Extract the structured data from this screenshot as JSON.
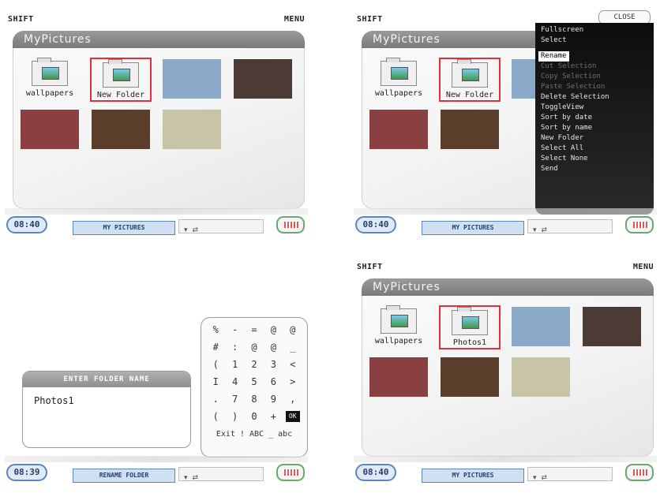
{
  "screens": [
    {
      "top_left": "SHIFT",
      "top_right": "MENU",
      "window_title": "MyPictures",
      "items": [
        {
          "type": "folder",
          "caption": "wallpapers",
          "selected": false
        },
        {
          "type": "folder",
          "caption": "New Folder",
          "selected": true
        },
        {
          "type": "photo",
          "caption": "",
          "selected": false,
          "color": "#8aa8c8"
        },
        {
          "type": "photo",
          "caption": "",
          "selected": false,
          "color": "#4b3b34"
        },
        {
          "type": "photo",
          "caption": "",
          "selected": false,
          "color": "#8a4040"
        },
        {
          "type": "photo",
          "caption": "",
          "selected": false,
          "color": "#5a3d2b"
        },
        {
          "type": "photo",
          "caption": "",
          "selected": false,
          "color": "#c8c4a8"
        }
      ],
      "time": "08:40",
      "bottom_label": "MY PICTURES"
    },
    {
      "top_left": "SHIFT",
      "close_label": "CLOSE",
      "window_title": "MyPictures",
      "items": [
        {
          "type": "folder",
          "caption": "wallpapers",
          "selected": false
        },
        {
          "type": "folder",
          "caption": "New Folder",
          "selected": true
        },
        {
          "type": "photo",
          "caption": "",
          "selected": false,
          "color": "#8aa8c8"
        },
        {
          "type": "photo",
          "caption": "",
          "selected": false,
          "color": "#8a4040"
        },
        {
          "type": "photo",
          "caption": "",
          "selected": false,
          "color": "#5a3d2b"
        }
      ],
      "menu": [
        {
          "label": "Fullscreen",
          "state": "enabled"
        },
        {
          "label": "Select",
          "state": "enabled"
        },
        {
          "label": "Rename",
          "state": "active"
        },
        {
          "label": "Cut Selection",
          "state": "disabled"
        },
        {
          "label": "Copy Selection",
          "state": "disabled"
        },
        {
          "label": "Paste Selection",
          "state": "disabled"
        },
        {
          "label": "Delete Selection",
          "state": "enabled"
        },
        {
          "label": "ToggleView",
          "state": "enabled"
        },
        {
          "label": "Sort by date",
          "state": "enabled"
        },
        {
          "label": "Sort by name",
          "state": "enabled"
        },
        {
          "label": "New Folder",
          "state": "enabled"
        },
        {
          "label": "Select All",
          "state": "enabled"
        },
        {
          "label": "Select None",
          "state": "enabled"
        },
        {
          "label": "Send",
          "state": "enabled"
        }
      ],
      "time": "08:40",
      "bottom_label": "MY PICTURES"
    },
    {
      "dialog_title": "ENTER FOLDER NAME",
      "dialog_value": "Photos1",
      "keypad": [
        [
          "%",
          "-",
          "=",
          "@",
          "@"
        ],
        [
          "#",
          ":",
          "@",
          "@",
          "_"
        ],
        [
          "(",
          "1",
          "2",
          "3",
          "<"
        ],
        [
          "I",
          "4",
          "5",
          "6",
          ">"
        ],
        [
          ".",
          "7",
          "8",
          "9",
          ","
        ],
        [
          "(",
          ")",
          "0",
          "+",
          "OK"
        ]
      ],
      "keypad_bottom": "Exit ! ABC _ abc",
      "time": "08:39",
      "bottom_label": "RENAME FOLDER"
    },
    {
      "top_left": "SHIFT",
      "top_right": "MENU",
      "window_title": "MyPictures",
      "items": [
        {
          "type": "folder",
          "caption": "wallpapers",
          "selected": false
        },
        {
          "type": "folder",
          "caption": "Photos1",
          "selected": true
        },
        {
          "type": "photo",
          "caption": "",
          "selected": false,
          "color": "#8aa8c8"
        },
        {
          "type": "photo",
          "caption": "",
          "selected": false,
          "color": "#4b3b34"
        },
        {
          "type": "photo",
          "caption": "",
          "selected": false,
          "color": "#8a4040"
        },
        {
          "type": "photo",
          "caption": "",
          "selected": false,
          "color": "#5a3d2b"
        },
        {
          "type": "photo",
          "caption": "",
          "selected": false,
          "color": "#c8c4a8"
        }
      ],
      "time": "08:40",
      "bottom_label": "MY PICTURES"
    }
  ]
}
